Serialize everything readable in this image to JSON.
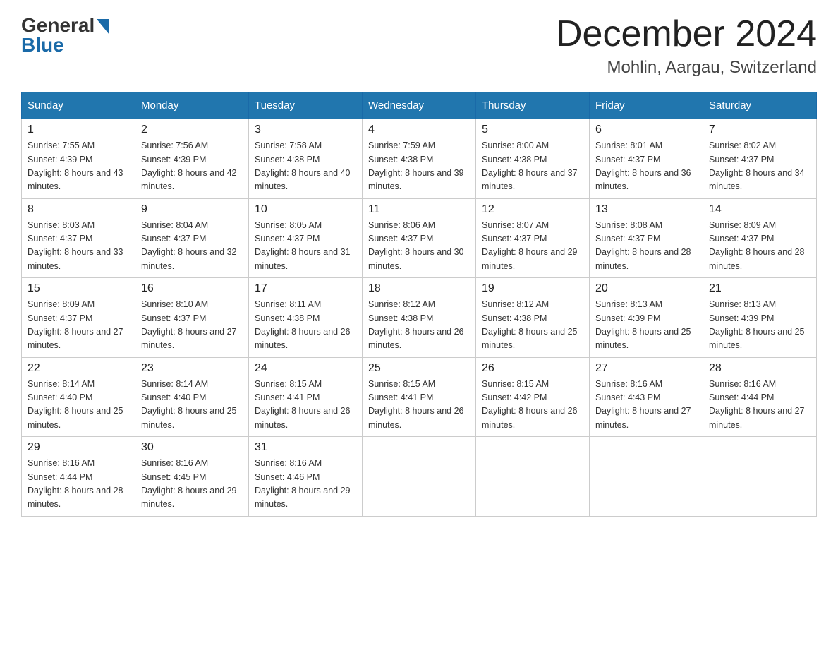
{
  "header": {
    "logo_general": "General",
    "logo_blue": "Blue",
    "month_title": "December 2024",
    "location": "Mohlin, Aargau, Switzerland"
  },
  "weekdays": [
    "Sunday",
    "Monday",
    "Tuesday",
    "Wednesday",
    "Thursday",
    "Friday",
    "Saturday"
  ],
  "weeks": [
    [
      {
        "day": "1",
        "sunrise": "7:55 AM",
        "sunset": "4:39 PM",
        "daylight": "8 hours and 43 minutes."
      },
      {
        "day": "2",
        "sunrise": "7:56 AM",
        "sunset": "4:39 PM",
        "daylight": "8 hours and 42 minutes."
      },
      {
        "day": "3",
        "sunrise": "7:58 AM",
        "sunset": "4:38 PM",
        "daylight": "8 hours and 40 minutes."
      },
      {
        "day": "4",
        "sunrise": "7:59 AM",
        "sunset": "4:38 PM",
        "daylight": "8 hours and 39 minutes."
      },
      {
        "day": "5",
        "sunrise": "8:00 AM",
        "sunset": "4:38 PM",
        "daylight": "8 hours and 37 minutes."
      },
      {
        "day": "6",
        "sunrise": "8:01 AM",
        "sunset": "4:37 PM",
        "daylight": "8 hours and 36 minutes."
      },
      {
        "day": "7",
        "sunrise": "8:02 AM",
        "sunset": "4:37 PM",
        "daylight": "8 hours and 34 minutes."
      }
    ],
    [
      {
        "day": "8",
        "sunrise": "8:03 AM",
        "sunset": "4:37 PM",
        "daylight": "8 hours and 33 minutes."
      },
      {
        "day": "9",
        "sunrise": "8:04 AM",
        "sunset": "4:37 PM",
        "daylight": "8 hours and 32 minutes."
      },
      {
        "day": "10",
        "sunrise": "8:05 AM",
        "sunset": "4:37 PM",
        "daylight": "8 hours and 31 minutes."
      },
      {
        "day": "11",
        "sunrise": "8:06 AM",
        "sunset": "4:37 PM",
        "daylight": "8 hours and 30 minutes."
      },
      {
        "day": "12",
        "sunrise": "8:07 AM",
        "sunset": "4:37 PM",
        "daylight": "8 hours and 29 minutes."
      },
      {
        "day": "13",
        "sunrise": "8:08 AM",
        "sunset": "4:37 PM",
        "daylight": "8 hours and 28 minutes."
      },
      {
        "day": "14",
        "sunrise": "8:09 AM",
        "sunset": "4:37 PM",
        "daylight": "8 hours and 28 minutes."
      }
    ],
    [
      {
        "day": "15",
        "sunrise": "8:09 AM",
        "sunset": "4:37 PM",
        "daylight": "8 hours and 27 minutes."
      },
      {
        "day": "16",
        "sunrise": "8:10 AM",
        "sunset": "4:37 PM",
        "daylight": "8 hours and 27 minutes."
      },
      {
        "day": "17",
        "sunrise": "8:11 AM",
        "sunset": "4:38 PM",
        "daylight": "8 hours and 26 minutes."
      },
      {
        "day": "18",
        "sunrise": "8:12 AM",
        "sunset": "4:38 PM",
        "daylight": "8 hours and 26 minutes."
      },
      {
        "day": "19",
        "sunrise": "8:12 AM",
        "sunset": "4:38 PM",
        "daylight": "8 hours and 25 minutes."
      },
      {
        "day": "20",
        "sunrise": "8:13 AM",
        "sunset": "4:39 PM",
        "daylight": "8 hours and 25 minutes."
      },
      {
        "day": "21",
        "sunrise": "8:13 AM",
        "sunset": "4:39 PM",
        "daylight": "8 hours and 25 minutes."
      }
    ],
    [
      {
        "day": "22",
        "sunrise": "8:14 AM",
        "sunset": "4:40 PM",
        "daylight": "8 hours and 25 minutes."
      },
      {
        "day": "23",
        "sunrise": "8:14 AM",
        "sunset": "4:40 PM",
        "daylight": "8 hours and 25 minutes."
      },
      {
        "day": "24",
        "sunrise": "8:15 AM",
        "sunset": "4:41 PM",
        "daylight": "8 hours and 26 minutes."
      },
      {
        "day": "25",
        "sunrise": "8:15 AM",
        "sunset": "4:41 PM",
        "daylight": "8 hours and 26 minutes."
      },
      {
        "day": "26",
        "sunrise": "8:15 AM",
        "sunset": "4:42 PM",
        "daylight": "8 hours and 26 minutes."
      },
      {
        "day": "27",
        "sunrise": "8:16 AM",
        "sunset": "4:43 PM",
        "daylight": "8 hours and 27 minutes."
      },
      {
        "day": "28",
        "sunrise": "8:16 AM",
        "sunset": "4:44 PM",
        "daylight": "8 hours and 27 minutes."
      }
    ],
    [
      {
        "day": "29",
        "sunrise": "8:16 AM",
        "sunset": "4:44 PM",
        "daylight": "8 hours and 28 minutes."
      },
      {
        "day": "30",
        "sunrise": "8:16 AM",
        "sunset": "4:45 PM",
        "daylight": "8 hours and 29 minutes."
      },
      {
        "day": "31",
        "sunrise": "8:16 AM",
        "sunset": "4:46 PM",
        "daylight": "8 hours and 29 minutes."
      },
      null,
      null,
      null,
      null
    ]
  ]
}
